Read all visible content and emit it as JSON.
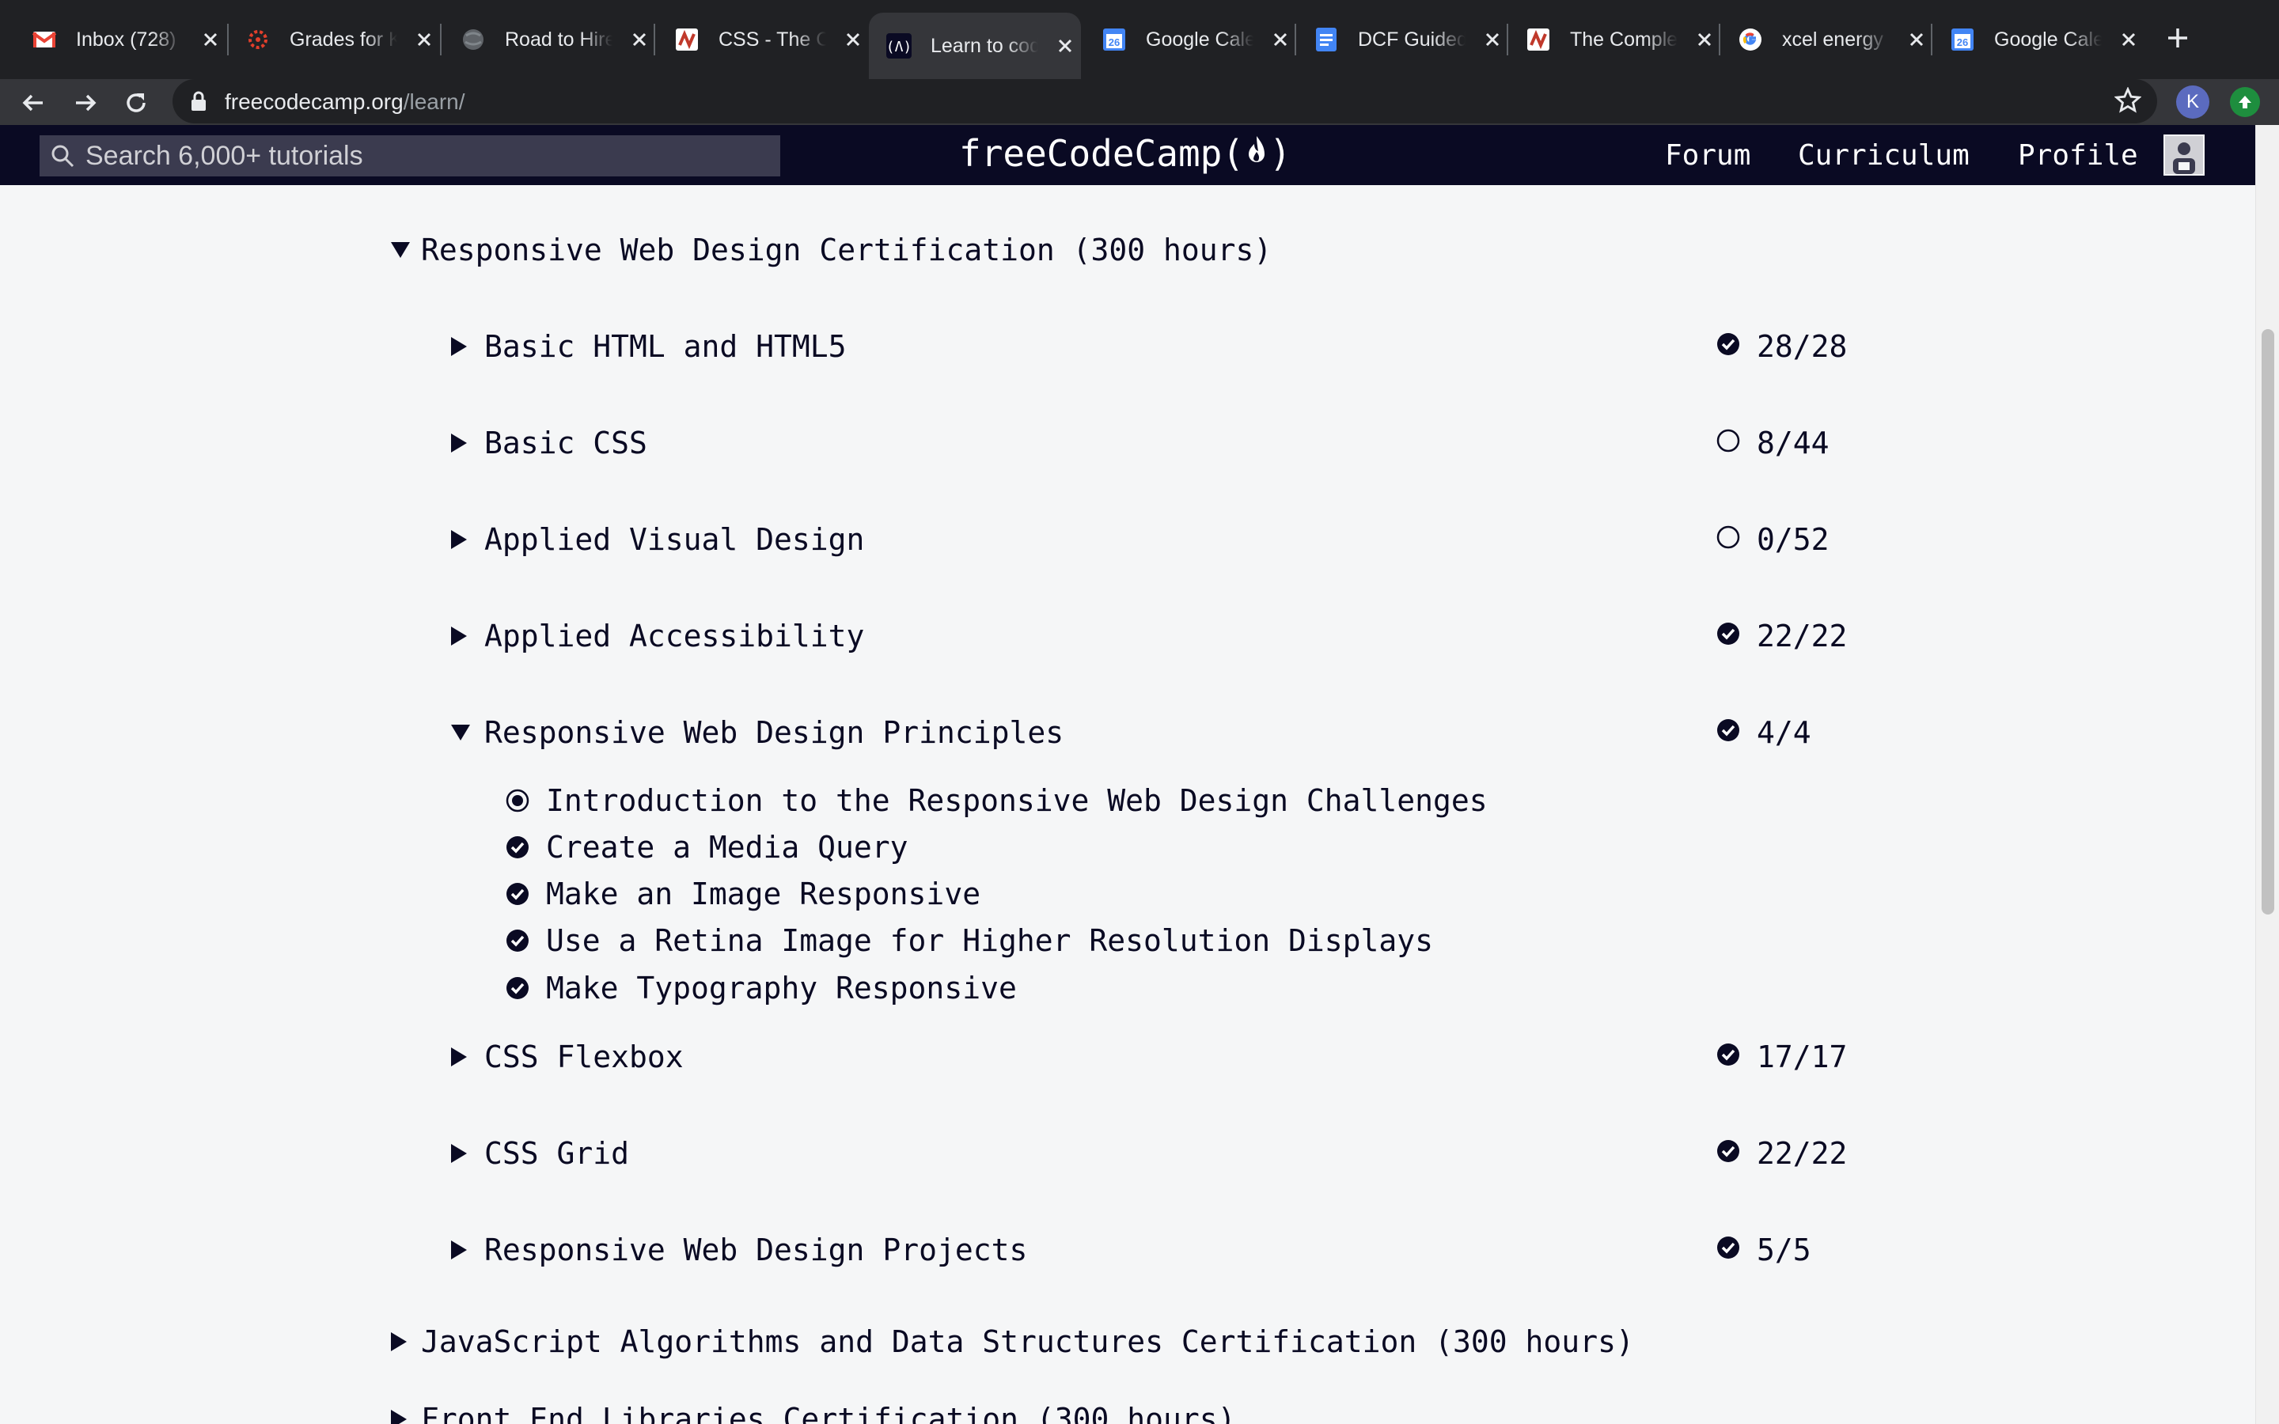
{
  "browser": {
    "tabs": [
      {
        "title": "Inbox (728)",
        "icon": "gmail-icon"
      },
      {
        "title": "Grades for K",
        "icon": "canvas-icon"
      },
      {
        "title": "Road to Hire",
        "icon": "globe-icon"
      },
      {
        "title": "CSS - The C",
        "icon": "lecture-icon"
      },
      {
        "title": "Learn to cod",
        "icon": "freecodecamp-icon",
        "active": true
      },
      {
        "title": "Google Cale",
        "icon": "google-calendar-icon"
      },
      {
        "title": "DCF Guided",
        "icon": "google-docs-icon"
      },
      {
        "title": "The Comple",
        "icon": "lecture-icon"
      },
      {
        "title": "xcel energy",
        "icon": "google-icon"
      },
      {
        "title": "Google Cale",
        "icon": "google-calendar-icon"
      }
    ],
    "url_host": "freecodecamp.org",
    "url_path": "/learn/",
    "profile_initial": "K"
  },
  "nav": {
    "search_placeholder": "Search 6,000+ tutorials",
    "logo_text_left": "freeCodeCamp(",
    "logo_text_right": ")",
    "links": [
      "Forum",
      "Curriculum",
      "Profile"
    ]
  },
  "curriculum": {
    "cert_open": "Responsive Web Design Certification (300 hours)",
    "blocks_before": [
      {
        "title": "Basic HTML and HTML5",
        "progress": "28/28",
        "complete": true
      },
      {
        "title": "Basic CSS",
        "progress": "8/44",
        "complete": false
      },
      {
        "title": "Applied Visual Design",
        "progress": "0/52",
        "complete": false
      },
      {
        "title": "Applied Accessibility",
        "progress": "22/22",
        "complete": true
      }
    ],
    "expanded_block": {
      "title": "Responsive Web Design Principles",
      "progress": "4/4",
      "complete": true
    },
    "challenges": [
      {
        "title": "Introduction to the Responsive Web Design Challenges",
        "status": "intro"
      },
      {
        "title": "Create a Media Query",
        "status": "complete"
      },
      {
        "title": "Make an Image Responsive",
        "status": "complete"
      },
      {
        "title": "Use a Retina Image for Higher Resolution Displays",
        "status": "complete"
      },
      {
        "title": "Make Typography Responsive",
        "status": "complete"
      }
    ],
    "blocks_after": [
      {
        "title": "CSS Flexbox",
        "progress": "17/17",
        "complete": true
      },
      {
        "title": "CSS Grid",
        "progress": "22/22",
        "complete": true
      },
      {
        "title": "Responsive Web Design Projects",
        "progress": "5/5",
        "complete": true
      }
    ],
    "cert_next": "JavaScript Algorithms and Data Structures Certification (300 hours)",
    "cert_partial": "Front End Libraries Certification (300 hours)"
  },
  "colors": {
    "navy": "#0a0a23",
    "page_bg": "#f5f6f7",
    "chrome_dark": "#202124",
    "chrome_mid": "#35363a"
  }
}
